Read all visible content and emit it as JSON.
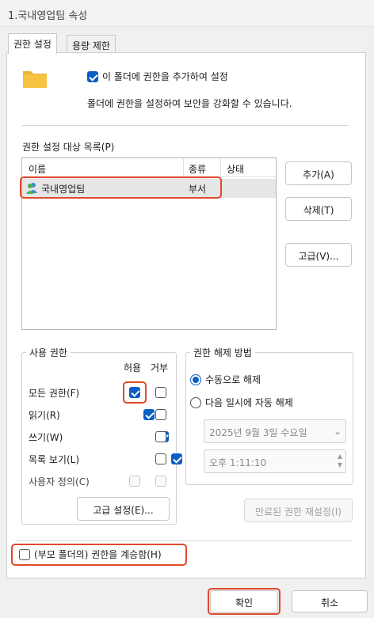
{
  "window": {
    "title": "1.국내영업팀 속성"
  },
  "tabs": [
    {
      "label": "권한 설정",
      "active": true
    },
    {
      "label": "용량 제한",
      "active": false
    }
  ],
  "add_permission": {
    "checked": true,
    "label": "이 폴더에 권한을 추가하여 설정"
  },
  "description": "폴더에 권한을 설정하여 보안을 강화할 수 있습니다.",
  "target_list": {
    "title": "권한 설정 대상 목록(P)",
    "columns": [
      "이름",
      "종류",
      "상태"
    ],
    "rows": [
      {
        "name": "국내영업팀",
        "type": "부서",
        "status": "",
        "icon": "group-users-icon"
      }
    ]
  },
  "side_buttons": {
    "add": "추가(A)",
    "delete": "삭제(T)",
    "advanced": "고급(V)..."
  },
  "usage_permissions": {
    "title": "사용 권한",
    "allow_label": "허용",
    "deny_label": "거부",
    "rows": [
      {
        "label": "모든 권한(F)",
        "allow": true,
        "deny": false,
        "disabled": false
      },
      {
        "label": "읽기(R)",
        "allow": true,
        "deny": false,
        "disabled": false
      },
      {
        "label": "쓰기(W)",
        "allow": true,
        "deny": false,
        "disabled": false
      },
      {
        "label": "목록 보기(L)",
        "allow": true,
        "deny": false,
        "disabled": false
      },
      {
        "label": "사용자 정의(C)",
        "allow": false,
        "deny": false,
        "disabled": true
      }
    ],
    "advanced_button": "고급 설정(E)..."
  },
  "release": {
    "title": "권한 해제 방법",
    "manual": "수동으로 해제",
    "auto": "다음 일시에 자동 해제",
    "selected": "manual",
    "date": "2025년   9월   3일 수요일",
    "time": "오후   1:11:10",
    "reset_button": "만료된 권한 재설정(I)"
  },
  "inherit": {
    "checked": false,
    "label": "(부모 폴더의) 권한을 계승함(H)"
  },
  "footer": {
    "ok": "확인",
    "cancel": "취소"
  },
  "colors": {
    "accent": "#0a5fc4",
    "highlight": "#e0492b",
    "folder": "#f5c242"
  }
}
